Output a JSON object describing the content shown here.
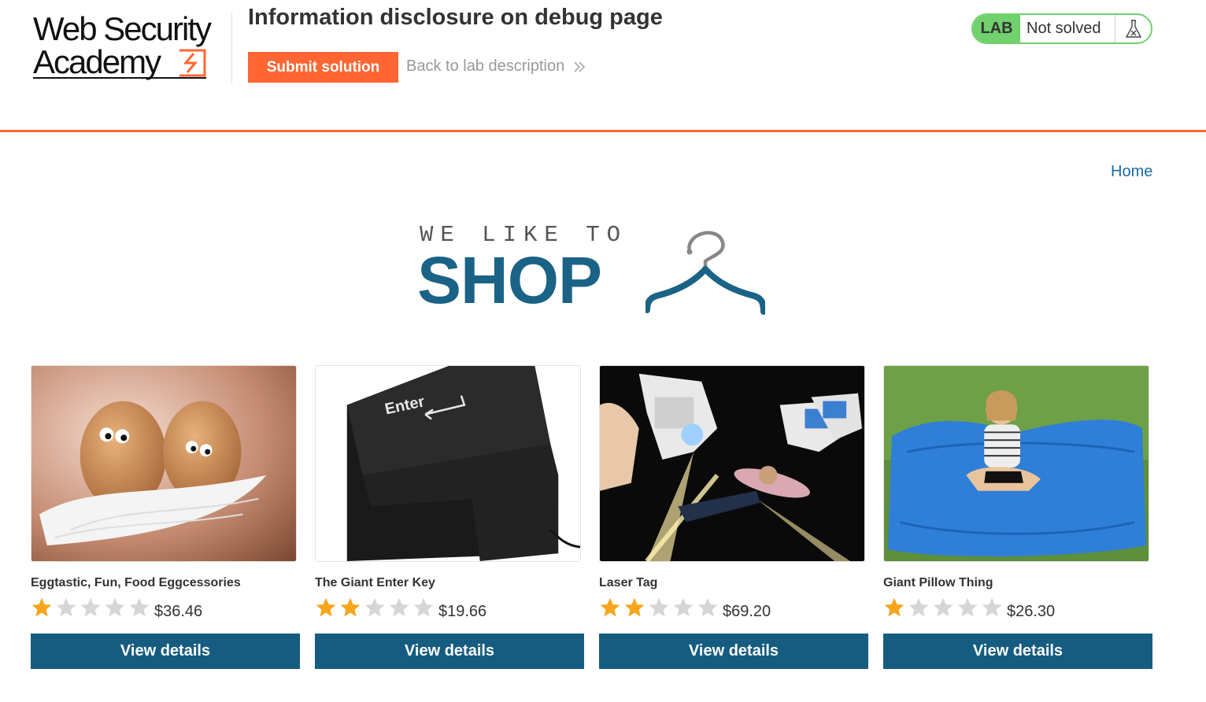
{
  "header": {
    "logo_line1": "Web Security",
    "logo_line2": "Academy",
    "lab_title": "Information disclosure on debug page",
    "submit_label": "Submit solution",
    "back_label": "Back to lab description",
    "lab_tag": "LAB",
    "lab_status": "Not solved"
  },
  "nav": {
    "home_label": "Home"
  },
  "banner": {
    "tagline": "WE LIKE TO",
    "title": "SHOP"
  },
  "colors": {
    "accent_orange": "#ff6633",
    "button_blue": "#165c80",
    "link_blue": "#1a6ca0",
    "lab_green": "#70d16d",
    "star_gold": "#f7a51c",
    "star_grey": "#d6d6d6"
  },
  "products": [
    {
      "name": "Eggtastic, Fun, Food Eggcessories",
      "rating": 1,
      "max_rating": 5,
      "price": "$36.46",
      "button": "View details",
      "image_icon": "eggs-image"
    },
    {
      "name": "The Giant Enter Key",
      "rating": 2,
      "max_rating": 5,
      "price": "$19.66",
      "button": "View details",
      "image_icon": "enter-key-image"
    },
    {
      "name": "Laser Tag",
      "rating": 2,
      "max_rating": 5,
      "price": "$69.20",
      "button": "View details",
      "image_icon": "laser-tag-image"
    },
    {
      "name": "Giant Pillow Thing",
      "rating": 1,
      "max_rating": 5,
      "price": "$26.30",
      "button": "View details",
      "image_icon": "pillow-image"
    }
  ]
}
